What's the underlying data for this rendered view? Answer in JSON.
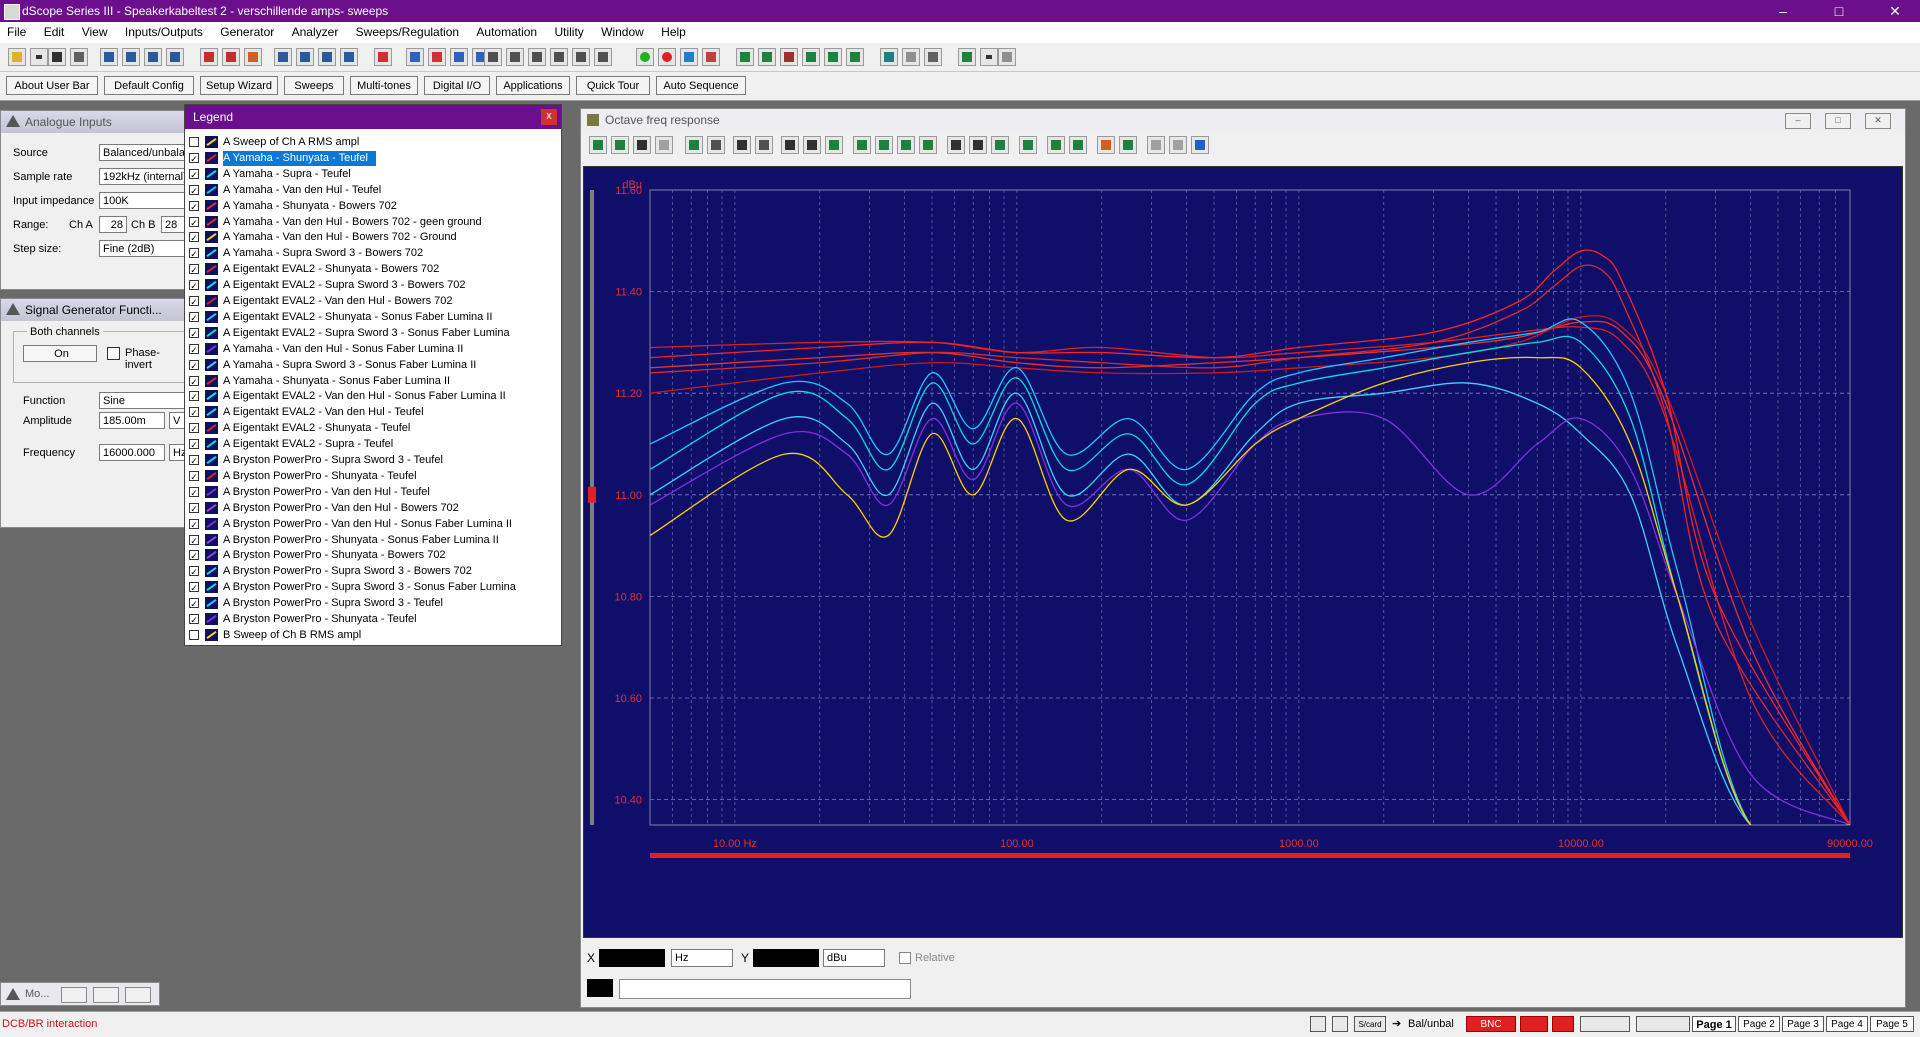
{
  "window": {
    "title": "dScope Series III - Speakerkabeltest 2 - verschillende amps- sweeps",
    "minimize": "–",
    "maximize": "□",
    "close": "✕"
  },
  "menu": [
    "File",
    "Edit",
    "View",
    "Inputs/Outputs",
    "Generator",
    "Analyzer",
    "Sweeps/Regulation",
    "Automation",
    "Utility",
    "Window",
    "Help"
  ],
  "userbar": [
    "About User Bar",
    "Default Config",
    "Setup Wizard",
    "Sweeps",
    "Multi-tones",
    "Digital I/O",
    "Applications",
    "Quick Tour",
    "Auto Sequence"
  ],
  "analogue": {
    "title": "Analogue Inputs",
    "source_label": "Source",
    "source_value": "Balanced/unbala",
    "rate_label": "Sample rate",
    "rate_value": "192kHz (internal)",
    "imp_label": "Input impedance",
    "imp_value": "100K",
    "range_label": "Range:",
    "cha_label": "Ch A",
    "cha_value": "28",
    "chb_label": "Ch B",
    "chb_value": "28",
    "step_label": "Step size:",
    "step_value": "Fine (2dB)"
  },
  "siggen": {
    "title": "Signal Generator Functi...",
    "group_label": "Both channels",
    "on_label": "On",
    "phase_label": "Phase-invert",
    "function_label": "Function",
    "function_value": "Sine",
    "amp_label": "Amplitude",
    "amp_value": "185.00m",
    "amp_unit": "V",
    "freq_label": "Frequency",
    "freq_value": "16000.000",
    "freq_unit": "Hz"
  },
  "minimized": {
    "title": "Mo..."
  },
  "legend": {
    "title": "Legend",
    "close": "x",
    "items": [
      {
        "label": "A  Sweep of Ch A RMS ampl",
        "checked": false,
        "color": "#ffd700",
        "selected": false
      },
      {
        "label": "A  Yamaha - Shunyata - Teufel",
        "checked": true,
        "color": "#e02020",
        "selected": true
      },
      {
        "label": "A  Yamaha - Supra - Teufel",
        "checked": true,
        "color": "#00e0e0",
        "selected": false
      },
      {
        "label": "A  Yamaha - Van den Hul - Teufel",
        "checked": true,
        "color": "#00c8e8",
        "selected": false
      },
      {
        "label": "A  Yamaha - Shunyata - Bowers 702",
        "checked": true,
        "color": "#e03030",
        "selected": false
      },
      {
        "label": "A  Yamaha - Van den Hul - Bowers 702 - geen ground",
        "checked": true,
        "color": "#e02828",
        "selected": false
      },
      {
        "label": "A  Yamaha - Van den Hul - Bowers 702 - Ground",
        "checked": true,
        "color": "#ffd000",
        "selected": false
      },
      {
        "label": "A  Yamaha - Supra Sword 3 - Bowers 702",
        "checked": true,
        "color": "#20d8f0",
        "selected": false
      },
      {
        "label": "A  Eigentakt EVAL2 - Shunyata - Bowers 702",
        "checked": true,
        "color": "#e02020",
        "selected": false
      },
      {
        "label": "A  Eigentakt EVAL2 - Supra Sword 3 - Bowers 702",
        "checked": true,
        "color": "#00e8e8",
        "selected": false
      },
      {
        "label": "A  Eigentakt EVAL2 - Van den Hul - Bowers 702",
        "checked": true,
        "color": "#d02020",
        "selected": false
      },
      {
        "label": "A  Eigentakt EVAL2 - Shunyata - Sonus Faber Lumina II",
        "checked": true,
        "color": "#30c0ff",
        "selected": false
      },
      {
        "label": "A  Eigentakt EVAL2 - Supra Sword 3 - Sonus Faber Lumina",
        "checked": true,
        "color": "#00e0d0",
        "selected": false
      },
      {
        "label": "A  Yamaha - Van den Hul - Sonus Faber Lumina II",
        "checked": true,
        "color": "#8030e0",
        "selected": false
      },
      {
        "label": "A  Yamaha - Supra Sword 3 - Sonus Faber Lumina II",
        "checked": true,
        "color": "#40d0ff",
        "selected": false
      },
      {
        "label": "A  Yamaha - Shunyata - Sonus Faber Lumina II",
        "checked": true,
        "color": "#e02020",
        "selected": false
      },
      {
        "label": "A  Eigentakt EVAL2 - Van den Hul - Sonus Faber Lumina II",
        "checked": true,
        "color": "#00e8e8",
        "selected": false
      },
      {
        "label": "A  Eigentakt EVAL2 - Van den Hul - Teufel",
        "checked": true,
        "color": "#20d0f0",
        "selected": false
      },
      {
        "label": "A  Eigentakt EVAL2 - Shunyata - Teufel",
        "checked": true,
        "color": "#e02020",
        "selected": false
      },
      {
        "label": "A  Eigentakt EVAL2 - Supra - Teufel",
        "checked": true,
        "color": "#00e0e0",
        "selected": false
      },
      {
        "label": "A  Bryston PowerPro - Supra Sword 3 - Teufel",
        "checked": true,
        "color": "#00d8f0",
        "selected": false
      },
      {
        "label": "A  Bryston PowerPro - Shunyata - Teufel",
        "checked": true,
        "color": "#e02020",
        "selected": false
      },
      {
        "label": "A  Bryston PowerPro - Van den Hul - Teufel",
        "checked": true,
        "color": "#8030e0",
        "selected": false
      },
      {
        "label": "A  Bryston PowerPro - Van den Hul - Bowers 702",
        "checked": true,
        "color": "#a040e0",
        "selected": false
      },
      {
        "label": "A  Bryston PowerPro - Van den Hul - Sonus Faber Lumina II",
        "checked": true,
        "color": "#7030d0",
        "selected": false
      },
      {
        "label": "A  Bryston PowerPro - Shunyata - Sonus Faber Lumina II",
        "checked": true,
        "color": "#8a40f0",
        "selected": false
      },
      {
        "label": "A  Bryston PowerPro - Shunyata - Bowers 702",
        "checked": true,
        "color": "#9040e0",
        "selected": false
      },
      {
        "label": "A  Bryston PowerPro - Supra Sword 3 - Bowers 702",
        "checked": true,
        "color": "#30c8f0",
        "selected": false
      },
      {
        "label": "A  Bryston PowerPro - Supra Sword 3 - Sonus Faber Lumina",
        "checked": true,
        "color": "#00e0e0",
        "selected": false
      },
      {
        "label": "A  Bryston PowerPro - Supra Sword 3 - Teufel",
        "checked": true,
        "color": "#20c8ff",
        "selected": false
      },
      {
        "label": "A  Bryston PowerPro - Shunyata - Teufel",
        "checked": true,
        "color": "#8030e0",
        "selected": false
      },
      {
        "label": "B  Sweep of Ch B RMS ampl",
        "checked": false,
        "color": "#ffd700",
        "selected": false
      }
    ]
  },
  "graph": {
    "title": "Octave freq response",
    "cursor": {
      "x_label": "X",
      "x_unit": "Hz",
      "y_label": "Y",
      "y_unit": "dBu",
      "relative_label": "Relative"
    }
  },
  "status": {
    "left_text": "DCB/BR interaction",
    "scard": "S/card",
    "balunbal": "Bal/unbal",
    "bnc": "BNC",
    "pages": [
      "Page 1",
      "Page 2",
      "Page 3",
      "Page 4",
      "Page 5"
    ]
  },
  "colors": {
    "plot_bg": "#0f0f6a",
    "grid": "#9a9ac8",
    "tick_label": "#e03030",
    "title_bar": "#6b0f8c"
  },
  "chart_data": {
    "type": "line",
    "title": "",
    "xlabel": "",
    "ylabel": "dBu",
    "x_scale": "log",
    "xlim": [
      5,
      90000
    ],
    "ylim": [
      10.35,
      11.6
    ],
    "x_ticks": [
      10,
      100,
      1000,
      10000,
      90000
    ],
    "x_tick_labels": [
      "10.00 Hz",
      "100.00",
      "1000.00",
      "10000.00",
      "90000.00"
    ],
    "y_ticks": [
      10.4,
      10.6,
      10.8,
      11.0,
      11.2,
      11.4,
      11.6
    ],
    "y_tick_labels": [
      "10.40",
      "10.60",
      "10.80",
      "11.00",
      "11.20",
      "11.40",
      "11.60"
    ],
    "grid": true,
    "series": [
      {
        "group": "red-flat",
        "color": "#e02020",
        "x": [
          5,
          20,
          50,
          100,
          200,
          500,
          1000,
          3000,
          6000,
          10000,
          14000,
          20000,
          40000,
          90000
        ],
        "y": [
          11.29,
          11.3,
          11.3,
          11.28,
          11.29,
          11.27,
          11.28,
          11.3,
          11.32,
          11.33,
          11.3,
          11.15,
          10.6,
          10.35
        ]
      },
      {
        "group": "red-flat",
        "color": "#e83030",
        "x": [
          5,
          20,
          50,
          100,
          200,
          500,
          1000,
          3000,
          6000,
          10000,
          14000,
          20000,
          40000,
          90000
        ],
        "y": [
          11.25,
          11.27,
          11.28,
          11.26,
          11.25,
          11.26,
          11.27,
          11.29,
          11.31,
          11.34,
          11.32,
          11.18,
          10.7,
          10.35
        ]
      },
      {
        "group": "red-flat",
        "color": "#d01818",
        "x": [
          5,
          20,
          50,
          100,
          200,
          500,
          1000,
          3000,
          6000,
          10000,
          14000,
          20000,
          40000,
          90000
        ],
        "y": [
          11.2,
          11.24,
          11.26,
          11.25,
          11.24,
          11.24,
          11.25,
          11.27,
          11.3,
          11.35,
          11.33,
          11.2,
          10.75,
          10.35
        ]
      },
      {
        "group": "red-peak",
        "color": "#ff2020",
        "x": [
          5,
          20,
          50,
          100,
          200,
          500,
          1000,
          3000,
          6000,
          8000,
          10000,
          12000,
          14000,
          20000,
          30000,
          90000
        ],
        "y": [
          11.27,
          11.29,
          11.3,
          11.28,
          11.28,
          11.27,
          11.29,
          11.32,
          11.38,
          11.44,
          11.48,
          11.47,
          11.42,
          11.2,
          10.8,
          10.35
        ]
      },
      {
        "group": "red-peak",
        "color": "#e02828",
        "x": [
          5,
          20,
          50,
          100,
          200,
          500,
          1000,
          3000,
          6000,
          8000,
          10000,
          12000,
          14000,
          20000,
          30000,
          90000
        ],
        "y": [
          11.24,
          11.26,
          11.28,
          11.27,
          11.26,
          11.25,
          11.27,
          11.3,
          11.36,
          11.41,
          11.45,
          11.44,
          11.38,
          11.16,
          10.75,
          10.35
        ]
      },
      {
        "group": "cyan-dip",
        "color": "#00e0e0",
        "x": [
          5,
          15,
          25,
          35,
          50,
          70,
          100,
          150,
          250,
          400,
          700,
          1000,
          2000,
          4000,
          7000,
          10000,
          15000,
          22000,
          40000,
          90000
        ],
        "y": [
          11.05,
          11.2,
          11.15,
          11.05,
          11.22,
          11.1,
          11.23,
          11.05,
          11.12,
          11.02,
          11.18,
          11.22,
          11.25,
          11.28,
          11.3,
          11.3,
          11.15,
          10.8,
          10.35,
          10.35
        ]
      },
      {
        "group": "cyan-dip",
        "color": "#20c8ff",
        "x": [
          5,
          15,
          25,
          35,
          50,
          70,
          100,
          150,
          250,
          400,
          700,
          1000,
          2000,
          4000,
          7000,
          10000,
          15000,
          22000,
          40000,
          90000
        ],
        "y": [
          11.1,
          11.22,
          11.18,
          11.08,
          11.24,
          11.13,
          11.25,
          11.08,
          11.15,
          11.05,
          11.2,
          11.24,
          11.27,
          11.3,
          11.32,
          11.34,
          11.2,
          10.85,
          10.35,
          10.35
        ]
      },
      {
        "group": "cyan-dip",
        "color": "#40d0ff",
        "x": [
          5,
          15,
          25,
          35,
          50,
          70,
          100,
          150,
          250,
          400,
          700,
          1000,
          2000,
          4000,
          7000,
          10000,
          15000,
          22000,
          40000,
          90000
        ],
        "y": [
          11.0,
          11.15,
          11.1,
          11.0,
          11.18,
          11.05,
          11.2,
          11.0,
          11.08,
          10.98,
          11.12,
          11.18,
          11.2,
          11.22,
          11.18,
          11.12,
          11.0,
          10.7,
          10.35,
          10.35
        ]
      },
      {
        "group": "purple-dip",
        "color": "#8030e0",
        "x": [
          5,
          15,
          25,
          35,
          50,
          70,
          100,
          150,
          250,
          400,
          700,
          1000,
          2000,
          4000,
          7000,
          10000,
          15000,
          22000,
          40000,
          90000
        ],
        "y": [
          10.98,
          11.12,
          11.08,
          10.98,
          11.15,
          11.03,
          11.18,
          10.98,
          11.05,
          10.95,
          11.1,
          11.15,
          11.15,
          11.0,
          11.1,
          11.15,
          11.05,
          10.8,
          10.45,
          10.35
        ]
      },
      {
        "group": "yellow-dip",
        "color": "#ffd000",
        "x": [
          5,
          15,
          25,
          35,
          50,
          70,
          100,
          150,
          250,
          400,
          700,
          1000,
          2000,
          4000,
          7000,
          10000,
          15000,
          22000,
          40000,
          90000
        ],
        "y": [
          10.92,
          11.08,
          11.0,
          10.92,
          11.12,
          11.0,
          11.15,
          10.95,
          11.05,
          10.98,
          11.1,
          11.15,
          11.22,
          11.26,
          11.27,
          11.25,
          11.1,
          10.8,
          10.35,
          10.35
        ]
      }
    ]
  }
}
